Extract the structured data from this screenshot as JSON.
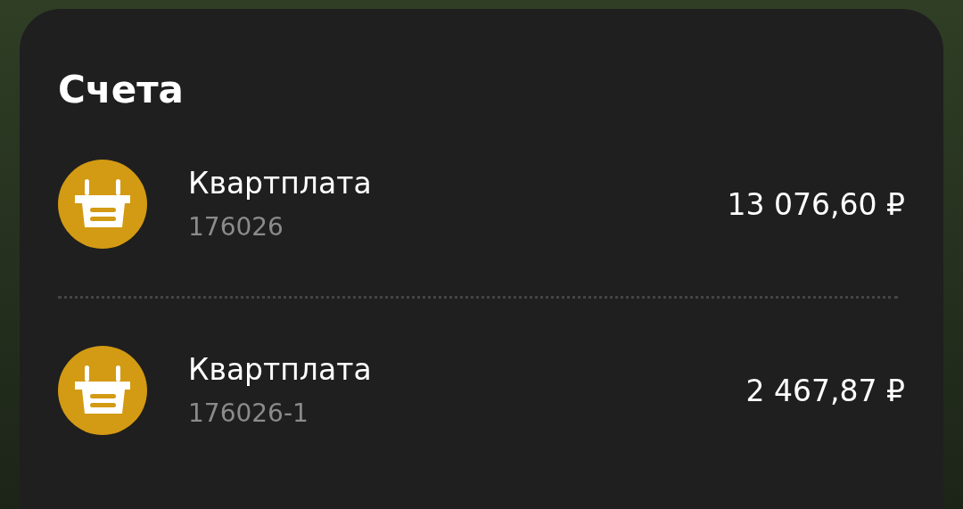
{
  "title": "Счета",
  "accounts": [
    {
      "name": "Квартплата",
      "number": "176026",
      "amount": "13 076,60 ₽"
    },
    {
      "name": "Квартплата",
      "number": "176026-1",
      "amount": "2 467,87 ₽"
    }
  ]
}
